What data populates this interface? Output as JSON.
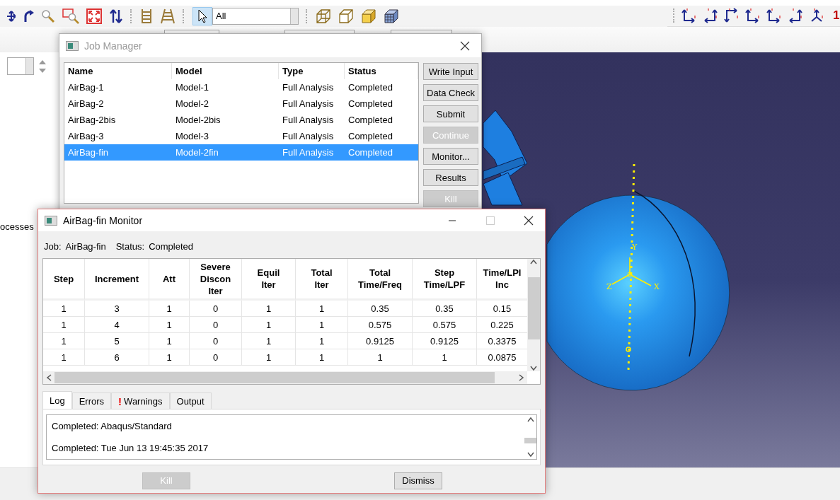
{
  "toolbar": {
    "selection_filter": "All",
    "cut_label": "1"
  },
  "side_panel": {
    "cut_text": "ocesses"
  },
  "viewport": {
    "triad_labels": [
      "Y",
      "Z",
      "X"
    ]
  },
  "job_manager": {
    "title": "Job Manager",
    "active": false,
    "table": {
      "columns": [
        "Name",
        "Model",
        "Type",
        "Status"
      ],
      "rows": [
        {
          "cells": [
            "AirBag-1",
            "Model-1",
            "Full Analysis",
            "Completed"
          ],
          "selected": false
        },
        {
          "cells": [
            "AirBag-2",
            "Model-2",
            "Full Analysis",
            "Completed"
          ],
          "selected": false
        },
        {
          "cells": [
            "AirBag-2bis",
            "Model-2bis",
            "Full Analysis",
            "Completed"
          ],
          "selected": false
        },
        {
          "cells": [
            "AirBag-3",
            "Model-3",
            "Full Analysis",
            "Completed"
          ],
          "selected": false
        },
        {
          "cells": [
            "AirBag-fin",
            "Model-2fin",
            "Full Analysis",
            "Completed"
          ],
          "selected": true
        }
      ]
    },
    "buttons": [
      {
        "label": "Write Input",
        "disabled": false
      },
      {
        "label": "Data Check",
        "disabled": false
      },
      {
        "label": "Submit",
        "disabled": false
      },
      {
        "label": "Continue",
        "disabled": true
      },
      {
        "label": "Monitor...",
        "disabled": false
      },
      {
        "label": "Results",
        "disabled": false
      },
      {
        "label": "Kill",
        "disabled": true
      }
    ]
  },
  "monitor": {
    "title": "AirBag-fin Monitor",
    "active": true,
    "job_label": "Job:",
    "job": "AirBag-fin",
    "status_label": "Status:",
    "status": "Completed",
    "table": {
      "columns": [
        "Step",
        "Increment",
        "Att",
        "Severe\nDiscon\nIter",
        "Equil\nIter",
        "Total\nIter",
        "Total\nTime/Freq",
        "Step\nTime/LPF",
        "Time/LPI\nInc"
      ],
      "rows": [
        [
          "1",
          "3",
          "1",
          "0",
          "1",
          "1",
          "0.35",
          "0.35",
          "0.15"
        ],
        [
          "1",
          "4",
          "1",
          "0",
          "1",
          "1",
          "0.575",
          "0.575",
          "0.225"
        ],
        [
          "1",
          "5",
          "1",
          "0",
          "1",
          "1",
          "0.9125",
          "0.9125",
          "0.3375"
        ],
        [
          "1",
          "6",
          "1",
          "0",
          "1",
          "1",
          "1",
          "1",
          "0.0875"
        ]
      ]
    },
    "tabs": [
      {
        "label": "Log",
        "selected": true
      },
      {
        "label": "Errors",
        "selected": false
      },
      {
        "label": "Warnings",
        "selected": false,
        "alert": "!"
      },
      {
        "label": "Output",
        "selected": false
      }
    ],
    "log": [
      "Completed: Abaqus/Standard",
      "Completed: Tue Jun 13 19:45:35 2017"
    ],
    "buttons": [
      {
        "label": "Kill",
        "disabled": true
      },
      {
        "label": "Dismiss",
        "disabled": false
      }
    ]
  }
}
